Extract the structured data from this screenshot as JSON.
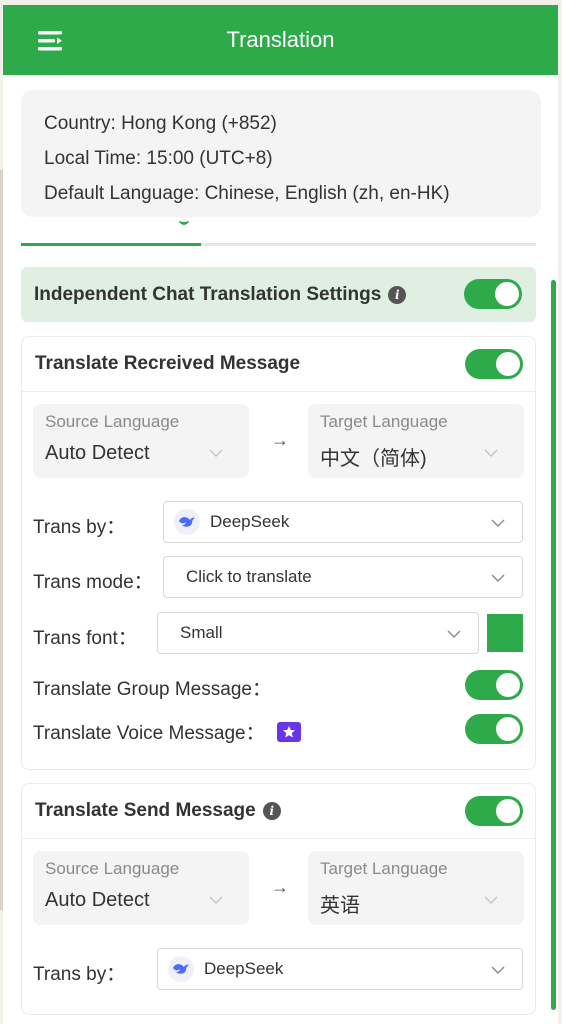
{
  "header": {
    "title": "Translation"
  },
  "info": {
    "country": "Country: Hong Kong (+852)",
    "local_time": "Local Time: 15:00 (UTC+8)",
    "default_language": "Default Language: Chinese, English (zh, en-HK)"
  },
  "independent": {
    "label": "Independent Chat Translation Settings",
    "enabled": true
  },
  "received": {
    "title": "Translate Recreived Message",
    "enabled": true,
    "source_label": "Source Language",
    "source_value": "Auto Detect",
    "target_label": "Target Language",
    "target_value": "中文（简体)",
    "arrow": "→",
    "trans_by_label": "Trans by：",
    "trans_by_value": "DeepSeek",
    "trans_mode_label": "Trans mode：",
    "trans_mode_value": "Click to translate",
    "trans_font_label": "Trans font：",
    "trans_font_value": "Small",
    "font_color": "#2eaa4a",
    "group_label": "Translate Group Message：",
    "group_enabled": true,
    "voice_label": "Translate Voice Message：",
    "voice_enabled": true
  },
  "send": {
    "title": "Translate Send Message",
    "enabled": true,
    "source_label": "Source Language",
    "source_value": "Auto Detect",
    "target_label": "Target Language",
    "target_value": "英语",
    "arrow": "→",
    "trans_by_label": "Trans by：",
    "trans_by_value": "DeepSeek"
  },
  "icons": {
    "menu": "menu-icon",
    "info": "info-icon",
    "chevron": "chevron-down-icon",
    "deepseek": "deepseek-whale-icon",
    "premium": "premium-star-icon"
  },
  "colors": {
    "accent": "#2eaa4a",
    "highlight_bg": "#dff0e2",
    "premium": "#6a34e8"
  }
}
